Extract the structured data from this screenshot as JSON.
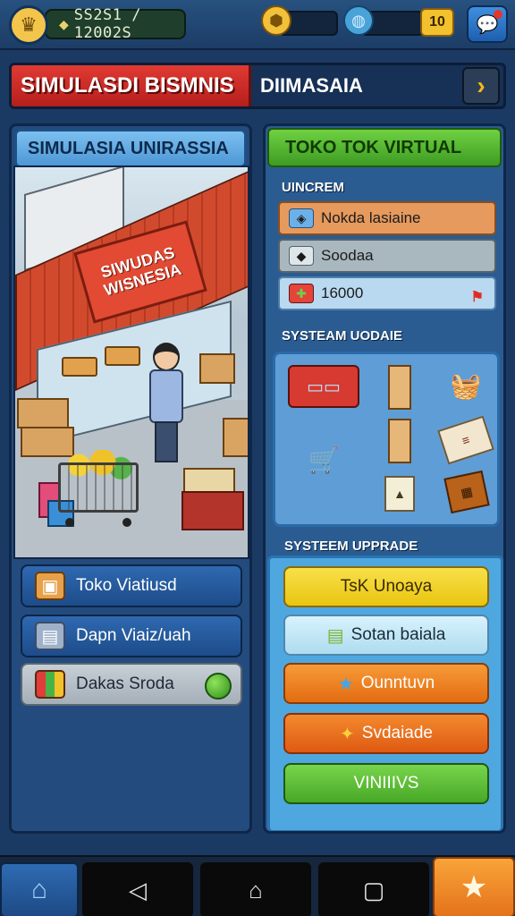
{
  "hud": {
    "money": "SS2S1 / 12002S",
    "gem_count": "10",
    "icons": [
      "crown-icon",
      "gold-shield-icon",
      "globe-icon",
      "chat-bubble-icon"
    ]
  },
  "title_banner": {
    "left_text": "SIMULASDI BISMNIS",
    "right_text": "DIIMASAIA"
  },
  "left_panel": {
    "header": "SIMULASIA UNIRASSIA",
    "scene_sign": "SIWUDAS WISNESIA",
    "buttons": [
      {
        "label": "Toko Viatiusd",
        "icon": "crate-icon"
      },
      {
        "label": "Dapn Viaiz/uah",
        "icon": "box-icon"
      },
      {
        "label": "Dakas Sroda",
        "icon": "gift-icon"
      }
    ]
  },
  "right_panel": {
    "header": "TOKO TOK VIRTUAL",
    "section1": "UINCREM",
    "rows": [
      {
        "label": "Nokda lasiaine",
        "icon": "package-icon",
        "color": "#e69a5d"
      },
      {
        "label": "Soodaa",
        "icon": "stone-icon",
        "color": "#a9b7be"
      },
      {
        "label": "16000",
        "icon": "gift-box-icon",
        "color": "#b9d9f0"
      }
    ],
    "section2": "SYSTEAM UODAIE",
    "section3": "SYSTEEM UPPRADE",
    "upgrade_buttons": [
      {
        "label": "TsK Unoaya",
        "color": "#f2d21c",
        "text_color": "#3a2a02"
      },
      {
        "label": "Sotan baiala",
        "color": "#bfe6f7",
        "text_color": "#1b2a38"
      },
      {
        "label": "Ounntuvn",
        "color": "#f07f1d",
        "text_color": "#ffffff"
      },
      {
        "label": "Svdaiade",
        "color": "#ed6a1c",
        "text_color": "#ffffff"
      },
      {
        "label": "VINIIIVS",
        "color": "#64c23a",
        "text_color": "#ffffff"
      }
    ]
  },
  "bottom_nav": {
    "items": [
      "home-icon",
      "back-icon",
      "home-outline-icon",
      "recents-icon",
      "star-icon"
    ]
  }
}
